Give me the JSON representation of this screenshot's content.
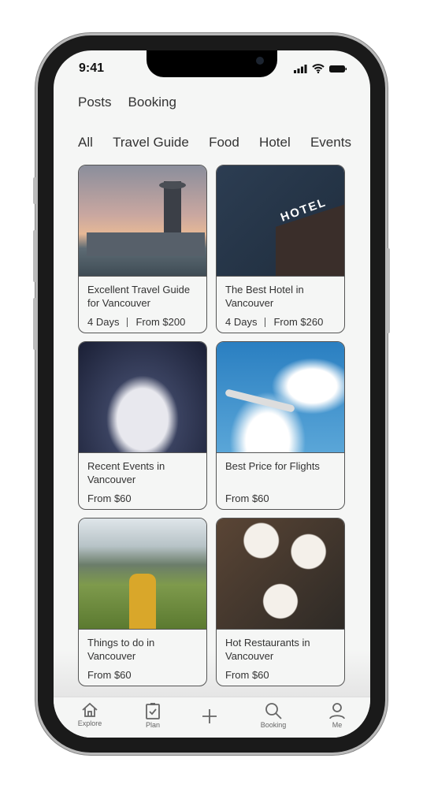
{
  "status": {
    "time": "9:41"
  },
  "top_tabs": [
    "Posts",
    "Booking"
  ],
  "categories": [
    "All",
    "Travel Guide",
    "Food",
    "Hotel",
    "Events"
  ],
  "cards": [
    {
      "title": "Excellent Travel Guide for Vancouver",
      "days": "4 Days",
      "price": "From $200"
    },
    {
      "title": "The Best Hotel in Vancouver",
      "days": "4 Days",
      "price": "From $260",
      "sign": "HOTEL"
    },
    {
      "title": "Recent Events in Vancouver",
      "price": "From $60"
    },
    {
      "title": "Best Price for Flights",
      "price": "From $60"
    },
    {
      "title": "Things to do in Vancouver",
      "price": "From $60"
    },
    {
      "title": "Hot Restaurants in Vancouver",
      "price": "From $60"
    }
  ],
  "nav": {
    "explore": "Explore",
    "plan": "Plan",
    "booking": "Booking",
    "me": "Me"
  }
}
